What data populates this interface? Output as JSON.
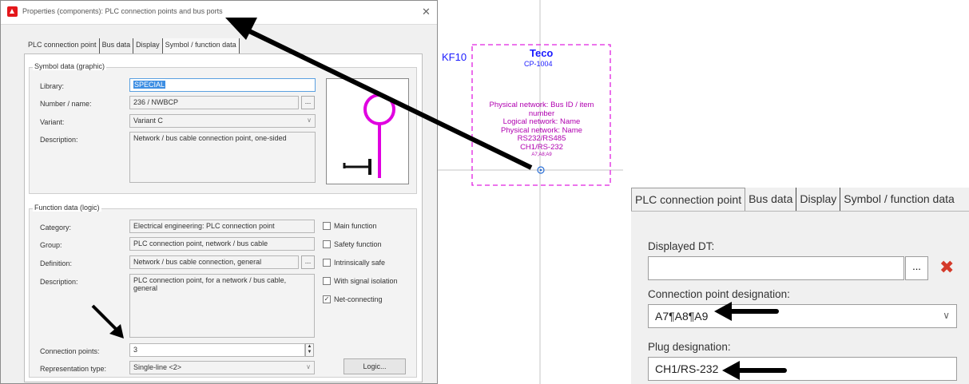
{
  "dialog": {
    "title": "Properties (components): PLC connection points and bus ports",
    "close_label": "✕",
    "tabs": [
      "PLC connection point",
      "Bus data",
      "Display",
      "Symbol / function data"
    ],
    "symbol_group": {
      "title": "Symbol data (graphic)",
      "library_label": "Library:",
      "library_value": "SPECIAL",
      "number_label": "Number / name:",
      "number_value": "236 / NWBCP",
      "variant_label": "Variant:",
      "variant_value": "Variant C",
      "description_label": "Description:",
      "description_value": "Network / bus cable connection point, one-sided"
    },
    "function_group": {
      "title": "Function data (logic)",
      "category_label": "Category:",
      "category_value": "Electrical engineering: PLC connection point",
      "group_label": "Group:",
      "group_value": "PLC connection point, network / bus cable",
      "definition_label": "Definition:",
      "definition_value": "Network / bus cable connection, general",
      "description_label": "Description:",
      "description_value": "PLC connection point, for a network / bus cable, general",
      "connection_points_label": "Connection points:",
      "connection_points_value": "3",
      "representation_label": "Representation type:",
      "representation_value": "Single-line <2>",
      "logic_button": "Logic...",
      "checkboxes": [
        {
          "label": "Main function",
          "checked": false
        },
        {
          "label": "Safety function",
          "checked": false
        },
        {
          "label": "Intrinsically safe",
          "checked": false
        },
        {
          "label": "With signal isolation",
          "checked": false
        },
        {
          "label": "Net-connecting",
          "checked": true
        }
      ]
    },
    "ellipsis_label": "...",
    "dropdown_glyph": "∨",
    "check_glyph": "✓"
  },
  "drawing": {
    "device_tag": "KF10",
    "manufacturer": "Teco",
    "part_number": "CP-1004",
    "lines": [
      "Physical network: Bus ID / item",
      "number",
      "Logical network: Name",
      "Physical network: Name",
      "RS232/RS485",
      "CH1/RS-232",
      "A7;A8;A9"
    ],
    "colors": {
      "frame": "#e020e0",
      "text": "#b000b0",
      "tag": "#1a1aff",
      "symbol": "#e000e0"
    }
  },
  "zoom": {
    "tabs": [
      "PLC connection point",
      "Bus data",
      "Display",
      "Symbol / function data"
    ],
    "displayed_dt_label": "Displayed DT:",
    "displayed_dt_value": "",
    "dots_label": "...",
    "delete_label": "✖",
    "cp_designation_label": "Connection point designation:",
    "cp_designation_value": "A7¶A8¶A9",
    "plug_label": "Plug designation:",
    "plug_value": "CH1/RS-232",
    "dropdown_glyph": "∨"
  }
}
